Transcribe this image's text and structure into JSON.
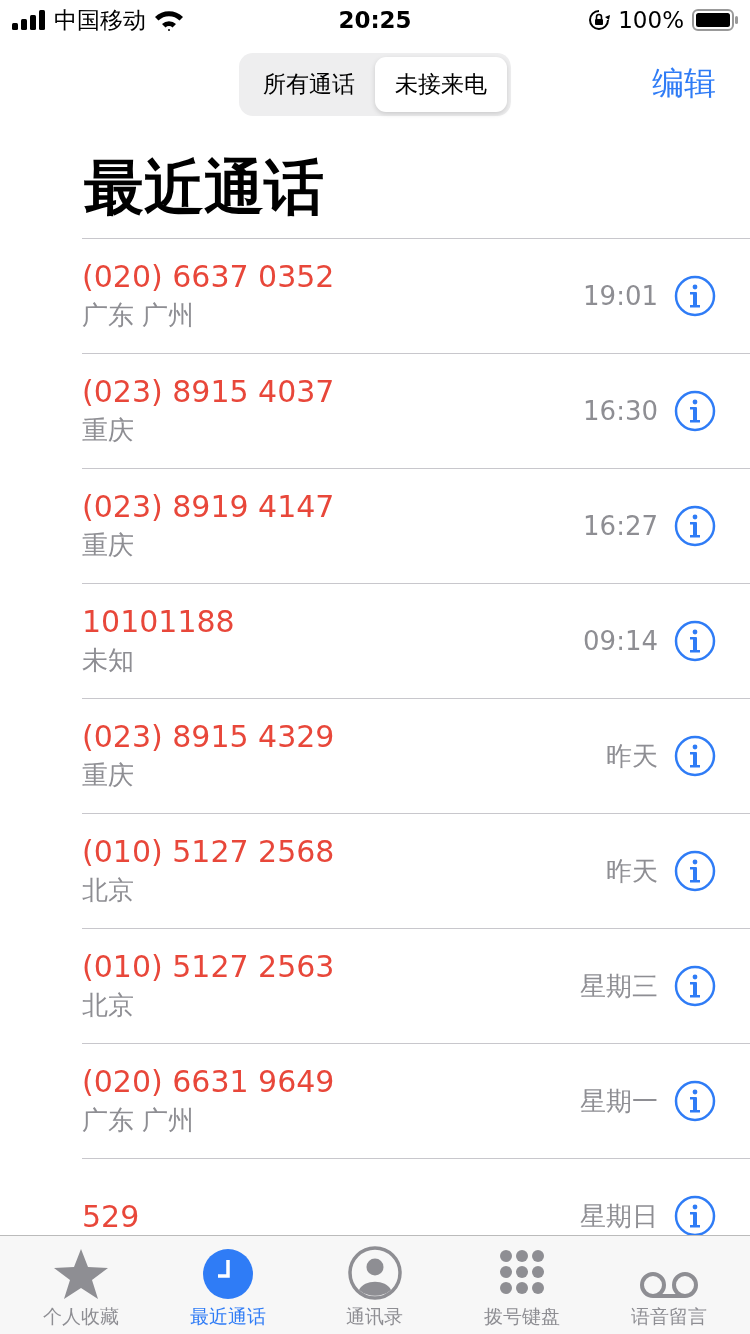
{
  "status_bar": {
    "carrier": "中国移动",
    "time": "20:25",
    "battery": "100%"
  },
  "segments": [
    {
      "label": "所有通话",
      "selected": false
    },
    {
      "label": "未接来电",
      "selected": true
    }
  ],
  "edit_button": "编辑",
  "title": "最近通话",
  "calls": [
    {
      "number": "(020) 6637 0352",
      "location": "广东 广州",
      "time": "19:01"
    },
    {
      "number": "(023) 8915 4037",
      "location": "重庆",
      "time": "16:30"
    },
    {
      "number": "(023) 8919 4147",
      "location": "重庆",
      "time": "16:27"
    },
    {
      "number": "10101188",
      "location": "未知",
      "time": "09:14"
    },
    {
      "number": "(023) 8915 4329",
      "location": "重庆",
      "time": "昨天"
    },
    {
      "number": "(010) 5127 2568",
      "location": "北京",
      "time": "昨天"
    },
    {
      "number": "(010) 5127 2563",
      "location": "北京",
      "time": "星期三"
    },
    {
      "number": "(020) 6631 9649",
      "location": "广东 广州",
      "time": "星期一"
    },
    {
      "number": "529",
      "time": "星期日"
    }
  ],
  "tab_bar": [
    {
      "kind": "star",
      "label": "个人收藏",
      "selected": false
    },
    {
      "kind": "clock",
      "label": "最近通话",
      "selected": true
    },
    {
      "kind": "contact",
      "label": "通讯录",
      "selected": false
    },
    {
      "kind": "keypad",
      "label": "拨号键盘",
      "selected": false
    },
    {
      "kind": "voicemail",
      "label": "语音留言",
      "selected": false
    }
  ]
}
